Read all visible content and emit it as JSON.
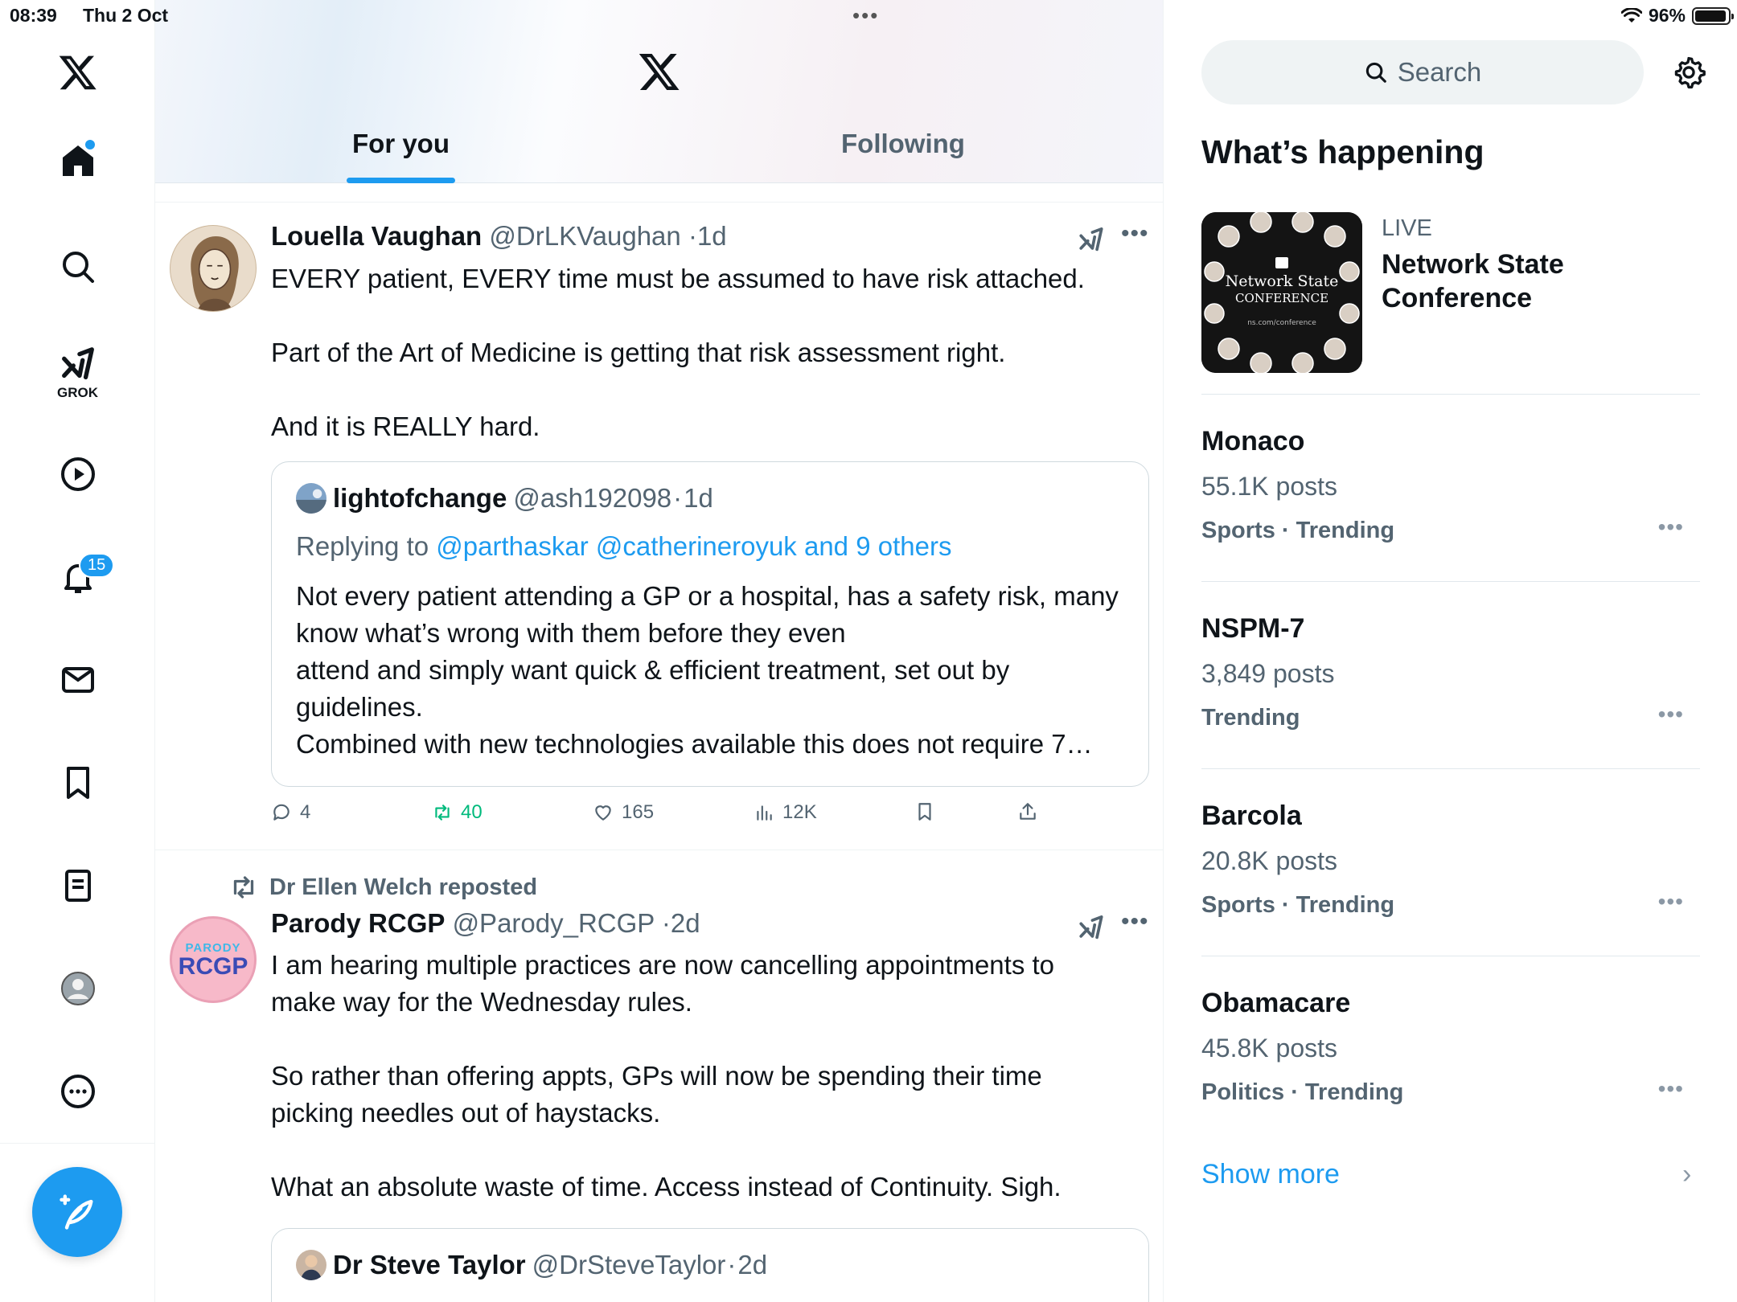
{
  "status_bar": {
    "time": "08:39",
    "date": "Thu 2 Oct",
    "battery": "96%"
  },
  "nav": {
    "items": [
      "home",
      "explore",
      "grok",
      "video",
      "notifications",
      "messages",
      "bookmarks",
      "lists",
      "profile",
      "more"
    ],
    "grok_label": "GROK",
    "notification_count": "15"
  },
  "tabs": {
    "for_you": "For you",
    "following": "Following"
  },
  "tweets": [
    {
      "name": "Louella Vaughan",
      "handle": "@DrLKVaughan",
      "time": "1d",
      "body": "EVERY patient, EVERY time must be assumed to have risk attached.\n\nPart of the Art of Medicine is getting that risk assessment right.\n\nAnd it is REALLY hard.",
      "quote": {
        "name": "lightofchange",
        "handle": "@ash192098",
        "time": "1d",
        "replying_prefix": "Replying to",
        "replying_to": "@parthaskar @catherineroyuk and 9 others",
        "body": "Not every patient attending a GP or a hospital, has a safety risk, many know what’s wrong with them before they even\nattend and simply want quick & efficient treatment, set out by guidelines.\nCombined with new technologies available this does not require 7…"
      },
      "stats": {
        "replies": "4",
        "reposts": "40",
        "likes": "165",
        "views": "12K"
      }
    },
    {
      "reposted_by": "Dr Ellen Welch reposted",
      "name": "Parody RCGP",
      "handle": "@Parody_RCGP",
      "time": "2d",
      "avatar_top": "PARODY",
      "avatar_main": "RCGP",
      "body": "I am hearing multiple practices are now cancelling appointments to make way for the Wednesday rules.\n\nSo rather than offering appts, GPs will now be spending their time picking needles out of haystacks.\n\nWhat an absolute waste of time. Access instead of Continuity. Sigh.",
      "quote": {
        "name": "Dr Steve Taylor",
        "handle": "@DrSteveTaylor",
        "time": "2d"
      }
    }
  ],
  "right": {
    "search_placeholder": "Search",
    "title": "What’s happening",
    "live": {
      "tag": "LIVE",
      "title": "Network State Conference",
      "image_line1": "Network State",
      "image_line2": "CONFERENCE",
      "image_url": "ns.com/conference"
    },
    "trends": [
      {
        "name": "Monaco",
        "count": "55.1K posts",
        "category": "Sports · Trending"
      },
      {
        "name": "NSPM-7",
        "count": "3,849 posts",
        "category": "Trending"
      },
      {
        "name": "Barcola",
        "count": "20.8K posts",
        "category": "Sports · Trending"
      },
      {
        "name": "Obamacare",
        "count": "45.8K posts",
        "category": "Politics · Trending"
      }
    ],
    "show_more": "Show more"
  },
  "colors": {
    "accent": "#1d9bf0",
    "repost_green": "#00ba7c",
    "secondary_text": "#536471"
  }
}
